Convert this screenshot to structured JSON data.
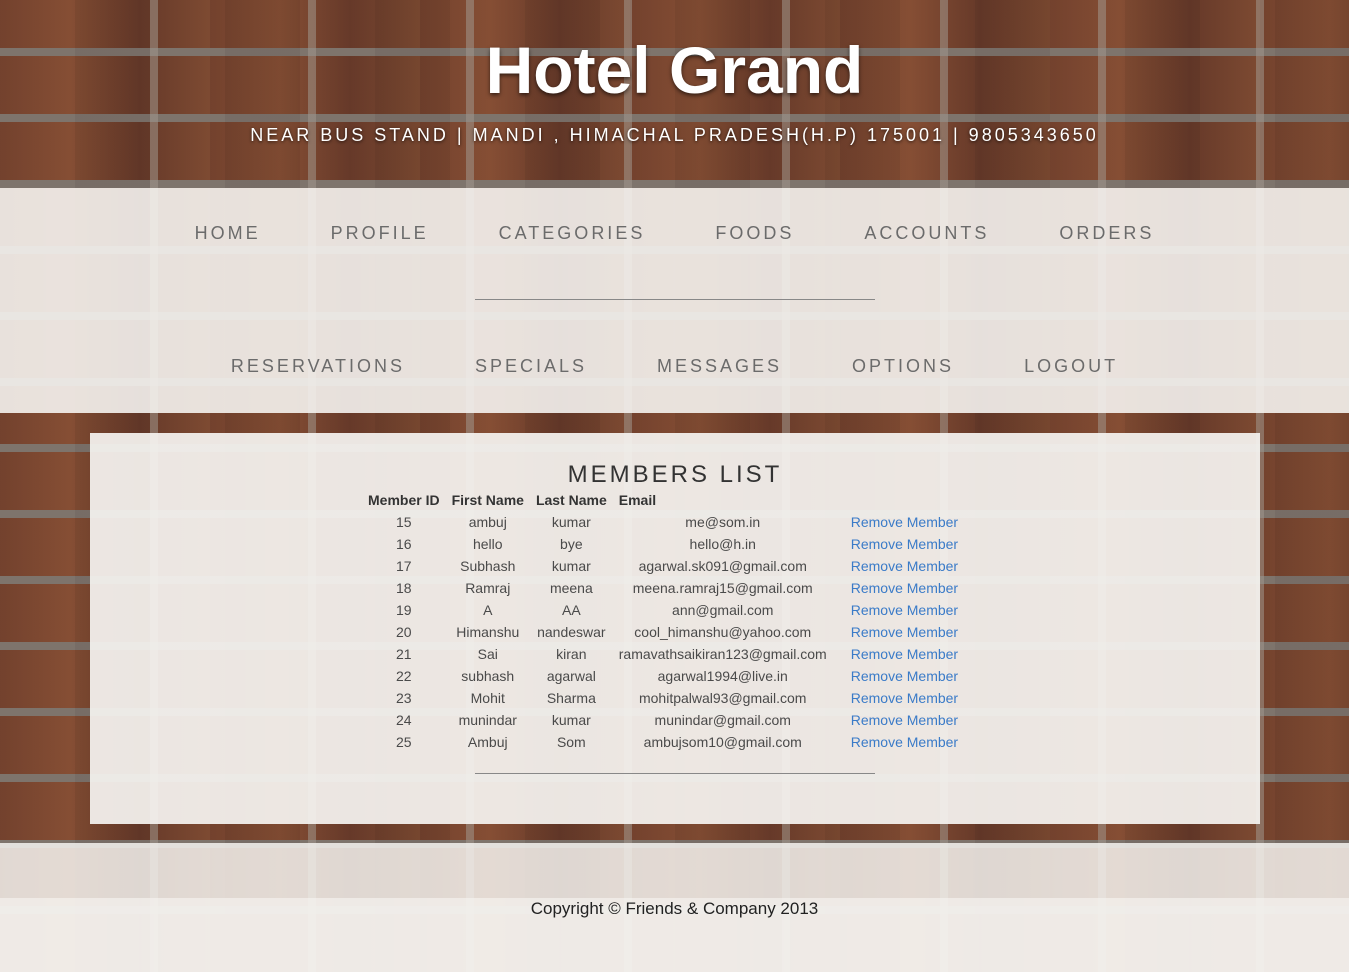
{
  "header": {
    "title": "Hotel Grand",
    "address": "NEAR BUS STAND | MANDI , HIMACHAL PRADESH(H.P) 175001 | 9805343650"
  },
  "nav": {
    "row1": [
      "HOME",
      "PROFILE",
      "CATEGORIES",
      "FOODS",
      "ACCOUNTS",
      "ORDERS"
    ],
    "row2": [
      "RESERVATIONS",
      "SPECIALS",
      "MESSAGES",
      "OPTIONS",
      "LOGOUT"
    ]
  },
  "members": {
    "title": "MEMBERS LIST",
    "columns": [
      "Member ID",
      "First Name",
      "Last Name",
      "Email"
    ],
    "action_label": "Remove Member",
    "rows": [
      {
        "id": "15",
        "first": "ambuj",
        "last": "kumar",
        "email": "me@som.in"
      },
      {
        "id": "16",
        "first": "hello",
        "last": "bye",
        "email": "hello@h.in"
      },
      {
        "id": "17",
        "first": "Subhash",
        "last": "kumar",
        "email": "agarwal.sk091@gmail.com"
      },
      {
        "id": "18",
        "first": "Ramraj",
        "last": "meena",
        "email": "meena.ramraj15@gmail.com"
      },
      {
        "id": "19",
        "first": "A",
        "last": "AA",
        "email": "ann@gmail.com"
      },
      {
        "id": "20",
        "first": "Himanshu",
        "last": "nandeswar",
        "email": "cool_himanshu@yahoo.com"
      },
      {
        "id": "21",
        "first": "Sai",
        "last": "kiran",
        "email": "ramavathsaikiran123@gmail.com"
      },
      {
        "id": "22",
        "first": "subhash",
        "last": "agarwal",
        "email": "agarwal1994@live.in"
      },
      {
        "id": "23",
        "first": "Mohit",
        "last": "Sharma",
        "email": "mohitpalwal93@gmail.com"
      },
      {
        "id": "24",
        "first": "munindar",
        "last": "kumar",
        "email": "munindar@gmail.com"
      },
      {
        "id": "25",
        "first": "Ambuj",
        "last": "Som",
        "email": "ambujsom10@gmail.com"
      }
    ]
  },
  "footer": {
    "copyright": "Copyright © Friends & Company 2013"
  },
  "colors": {
    "link": "#3a7bc8",
    "nav_text": "#6b6b6b",
    "panel": "#f5f3f0"
  }
}
